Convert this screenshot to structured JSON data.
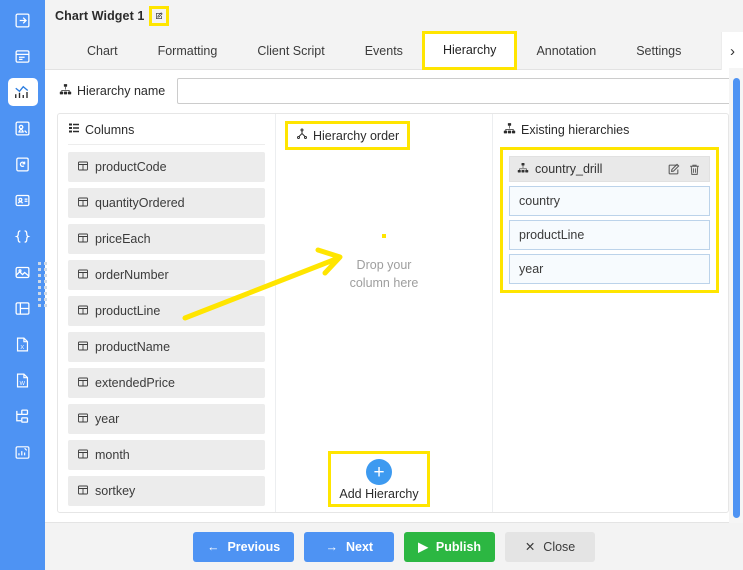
{
  "window": {
    "title": "Chart Widget 1",
    "edit_icon": "edit-pencil-icon"
  },
  "tabs": {
    "items": [
      {
        "label": "Chart",
        "active": false
      },
      {
        "label": "Formatting",
        "active": false
      },
      {
        "label": "Client Script",
        "active": false
      },
      {
        "label": "Events",
        "active": false
      },
      {
        "label": "Hierarchy",
        "active": true
      },
      {
        "label": "Annotation",
        "active": false
      },
      {
        "label": "Settings",
        "active": false
      }
    ],
    "more_icon": "chevron-right-icon"
  },
  "hierarchy_name": {
    "label": "Hierarchy name",
    "icon": "hierarchy-icon",
    "value": "",
    "placeholder": ""
  },
  "columns_panel": {
    "title": "Columns",
    "icon": "columns-list-icon",
    "items": [
      {
        "label": "productCode"
      },
      {
        "label": "quantityOrdered"
      },
      {
        "label": "priceEach"
      },
      {
        "label": "orderNumber"
      },
      {
        "label": "productLine"
      },
      {
        "label": "productName"
      },
      {
        "label": "extendedPrice"
      },
      {
        "label": "year"
      },
      {
        "label": "month"
      },
      {
        "label": "sortkey"
      }
    ]
  },
  "hierarchy_order_panel": {
    "title": "Hierarchy order",
    "icon": "hierarchy-icon",
    "drop_line1": "Drop your",
    "drop_line2": "column here",
    "add_button": {
      "label": "Add Hierarchy",
      "icon": "plus-icon"
    }
  },
  "existing_hierarchies_panel": {
    "title": "Existing hierarchies",
    "icon": "hierarchy-icon",
    "groups": [
      {
        "name": "country_drill",
        "icon": "hierarchy-icon",
        "edit_icon": "edit-pencil-icon",
        "delete_icon": "trash-icon",
        "items": [
          {
            "label": "country"
          },
          {
            "label": "productLine"
          },
          {
            "label": "year"
          }
        ]
      }
    ]
  },
  "footer": {
    "buttons": [
      {
        "label": "Previous",
        "icon": "arrow-left-icon",
        "style": "blue"
      },
      {
        "label": "Next",
        "icon": "arrow-right-icon",
        "style": "blue"
      },
      {
        "label": "Publish",
        "icon": "play-icon",
        "style": "green"
      },
      {
        "label": "Close",
        "icon": "close-x-icon",
        "style": "grey"
      }
    ]
  },
  "sidebar": {
    "items": [
      {
        "name": "sidebar-item-export",
        "icon": "export-arrow-icon",
        "active": false
      },
      {
        "name": "sidebar-item-form",
        "icon": "form-window-icon",
        "active": false
      },
      {
        "name": "sidebar-item-chart",
        "icon": "chart-widget-icon",
        "active": true
      },
      {
        "name": "sidebar-item-map",
        "icon": "map-pin-icon",
        "active": false
      },
      {
        "name": "sidebar-item-refresh-doc",
        "icon": "document-refresh-icon",
        "active": false
      },
      {
        "name": "sidebar-item-card",
        "icon": "id-card-icon",
        "active": false
      },
      {
        "name": "sidebar-item-code",
        "icon": "curly-braces-icon",
        "active": false
      },
      {
        "name": "sidebar-item-image",
        "icon": "image-icon",
        "active": false
      },
      {
        "name": "sidebar-item-layout",
        "icon": "layout-panel-icon",
        "active": false
      },
      {
        "name": "sidebar-item-excel",
        "icon": "excel-file-icon",
        "active": false
      },
      {
        "name": "sidebar-item-word",
        "icon": "word-file-icon",
        "active": false
      },
      {
        "name": "sidebar-item-tree",
        "icon": "tree-structure-icon",
        "active": false
      },
      {
        "name": "sidebar-item-bar-chart",
        "icon": "bar-chart-icon",
        "active": false
      }
    ]
  },
  "colors": {
    "sidebar_blue": "#4e93f3",
    "accent_blue": "#4e93f3",
    "publish_green": "#2cb742",
    "highlight_yellow": "#ffe500",
    "panel_grey": "#ececec"
  }
}
